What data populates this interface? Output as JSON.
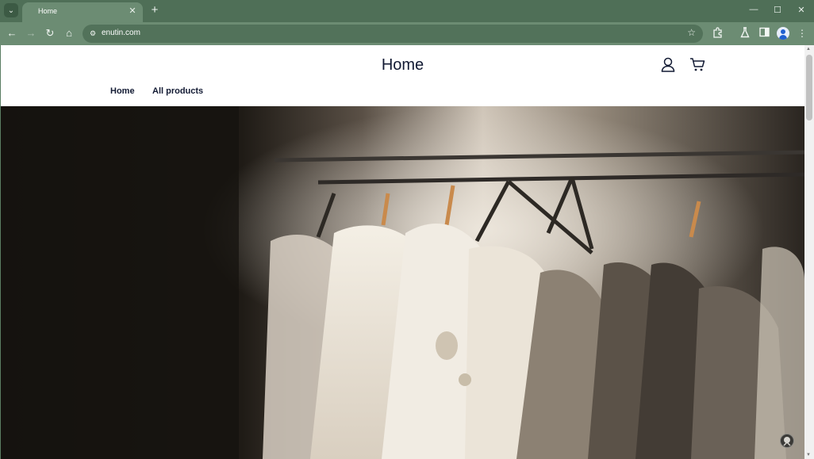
{
  "browser": {
    "tab_title": "Home",
    "tab_close": "✕",
    "new_tab": "+",
    "url": "enutin.com",
    "window_controls": [
      "—",
      "☐",
      "✕"
    ]
  },
  "toolbar": {
    "back": "←",
    "forward": "→",
    "reload": "↻",
    "home": "⌂",
    "bookmark": "☆",
    "menu": "⋮"
  },
  "site": {
    "title": "Home",
    "nav": [
      "Home",
      "All products"
    ]
  },
  "icons": {
    "account": "account-icon",
    "cart": "cart-icon"
  }
}
